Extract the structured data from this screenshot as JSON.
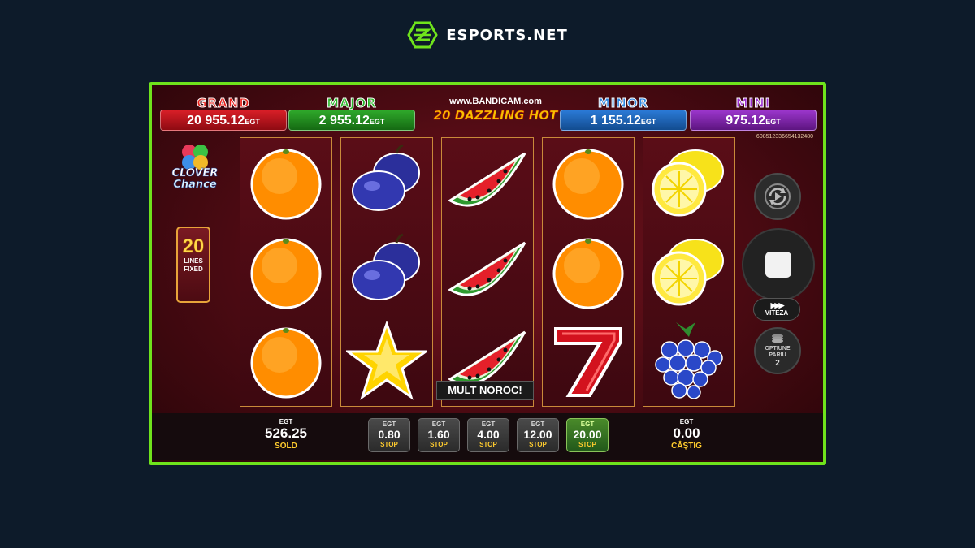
{
  "brand": {
    "name": "ESPORTS.NET"
  },
  "jackpots": [
    {
      "label": "GRAND",
      "value": "20 955.12",
      "unit": "EGT",
      "color": "#b4121b",
      "label_color": "#e8201a"
    },
    {
      "label": "MAJOR",
      "value": "2 955.12",
      "unit": "EGT",
      "color": "#1f8a1d",
      "label_color": "#27b627"
    },
    {
      "label": "MINOR",
      "value": "1 155.12",
      "unit": "EGT",
      "color": "#1b63b8",
      "label_color": "#2d86e0"
    },
    {
      "label": "MINI",
      "value": "975.12",
      "unit": "EGT",
      "color": "#7c22a8",
      "label_color": "#9b2fd0"
    }
  ],
  "watermark": "www.BANDICAM.com",
  "game_title": "20 DAZZLING HOT",
  "sequence_id": "608512336654132480",
  "clover": {
    "line1": "CLOVER",
    "line2": "Chance"
  },
  "lines_badge": {
    "count": "20",
    "line1": "LINES",
    "line2": "FIXED"
  },
  "reels": [
    [
      "orange-icon",
      "orange-icon",
      "orange-icon"
    ],
    [
      "plum-icon",
      "plum-icon",
      "star-icon"
    ],
    [
      "watermelon-icon",
      "watermelon-icon",
      "watermelon-icon"
    ],
    [
      "orange-icon",
      "orange-icon",
      "seven-icon"
    ],
    [
      "lemon-icon",
      "lemon-icon",
      "grapes-icon"
    ]
  ],
  "controls": {
    "speed_label": "VITEZA",
    "options_line1": "OPTIUNE",
    "options_line2": "PARIU",
    "options_count": "2"
  },
  "message": "MULT NOROC!",
  "balance": {
    "currency": "EGT",
    "value": "526.25",
    "label": "SOLD"
  },
  "win": {
    "currency": "EGT",
    "value": "0.00",
    "label": "CÂȘTIG"
  },
  "bets": [
    {
      "currency": "EGT",
      "value": "0.80",
      "label": "STOP",
      "active": false
    },
    {
      "currency": "EGT",
      "value": "1.60",
      "label": "STOP",
      "active": false
    },
    {
      "currency": "EGT",
      "value": "4.00",
      "label": "STOP",
      "active": false
    },
    {
      "currency": "EGT",
      "value": "12.00",
      "label": "STOP",
      "active": false
    },
    {
      "currency": "EGT",
      "value": "20.00",
      "label": "STOP",
      "active": true
    }
  ]
}
